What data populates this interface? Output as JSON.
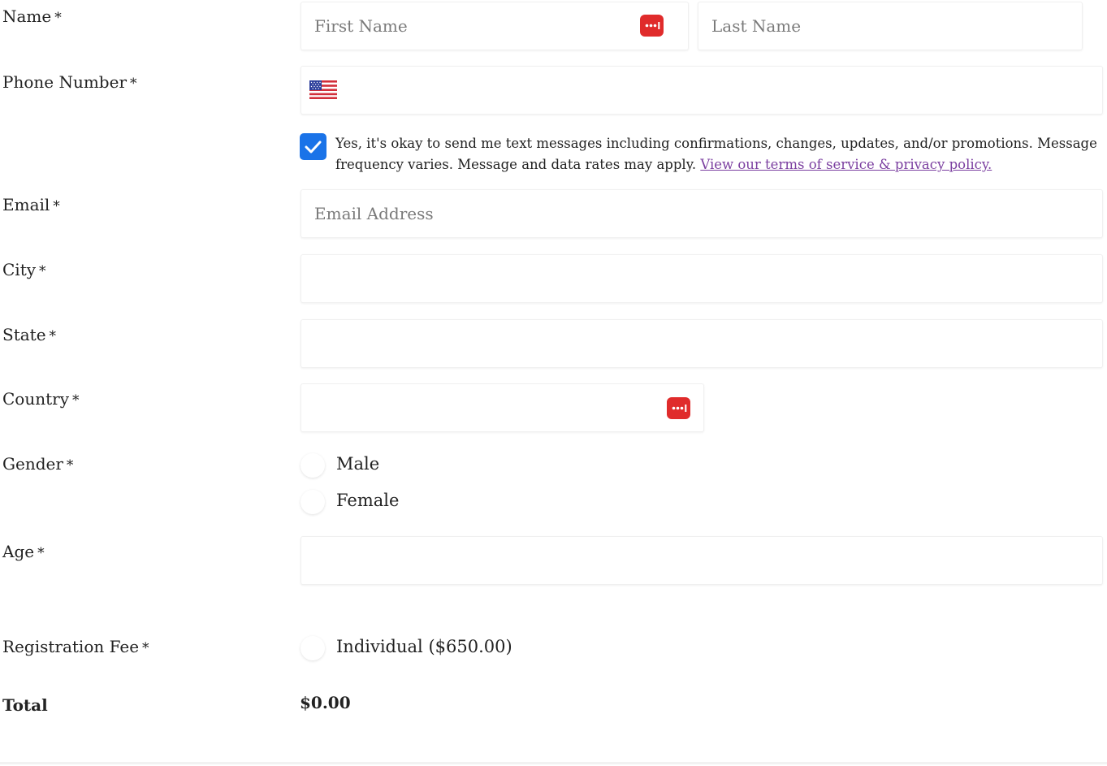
{
  "form": {
    "name": {
      "label": "Name",
      "required_mark": "*",
      "first_placeholder": "First Name",
      "last_placeholder": "Last Name",
      "first_value": "",
      "last_value": ""
    },
    "phone": {
      "label": "Phone Number",
      "required_mark": "*",
      "country_flag": "us-flag-icon",
      "value": ""
    },
    "sms_consent": {
      "checked": true,
      "text": "Yes, it's okay to send me text messages including confirmations, changes, updates, and/or promotions. Message frequency varies. Message and data rates may apply.",
      "link_text": "View our terms of service & privacy policy."
    },
    "email": {
      "label": "Email",
      "required_mark": "*",
      "placeholder": "Email Address",
      "value": ""
    },
    "city": {
      "label": "City",
      "required_mark": "*",
      "value": ""
    },
    "state": {
      "label": "State",
      "required_mark": "*",
      "value": ""
    },
    "country": {
      "label": "Country",
      "required_mark": "*",
      "value": ""
    },
    "gender": {
      "label": "Gender",
      "required_mark": "*",
      "options": [
        "Male",
        "Female"
      ],
      "selected": null
    },
    "age": {
      "label": "Age",
      "required_mark": "*",
      "value": ""
    },
    "registration_fee": {
      "label": "Registration Fee",
      "required_mark": "*",
      "options": [
        "Individual ($650.00)"
      ],
      "selected": null
    },
    "total": {
      "label": "Total",
      "value": "$0.00"
    }
  },
  "icons": {
    "password_manager": "password-manager-icon",
    "check": "checkmark-icon"
  },
  "colors": {
    "checkbox": "#1a73e8",
    "password_manager_icon": "#e02b2b",
    "link": "#7b3fa0"
  }
}
